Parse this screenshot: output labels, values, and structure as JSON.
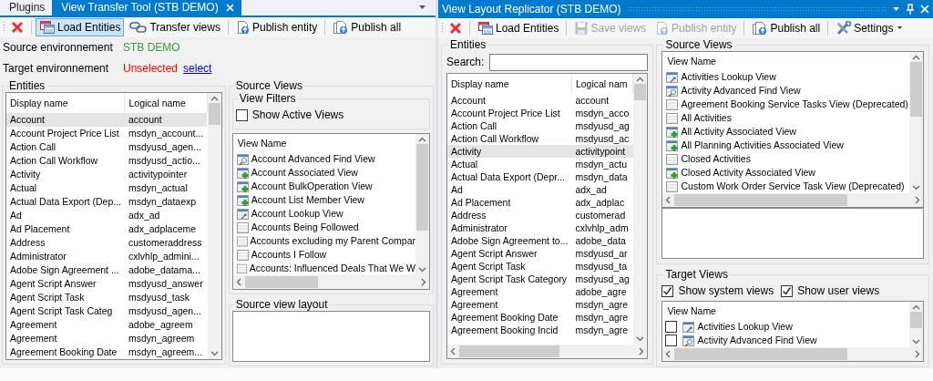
{
  "left_panel": {
    "tabs": [
      {
        "label": "Plugins",
        "selected": false
      },
      {
        "label": "View Transfer Tool (STB DEMO)",
        "selected": true
      }
    ],
    "toolbar": [
      {
        "kind": "close",
        "separator": false,
        "pressed": false
      },
      {
        "kind": "load",
        "label": "Load Entities",
        "separator": true,
        "pressed": true
      },
      {
        "kind": "transfer",
        "label": "Transfer views",
        "separator": false,
        "pressed": false
      },
      {
        "kind": "publish",
        "label": "Publish entity",
        "separator": true,
        "pressed": false
      },
      {
        "kind": "publish_all",
        "label": "Publish all",
        "separator": true,
        "pressed": false
      }
    ],
    "source_environment": {
      "label": "Source environnement",
      "value": "STB DEMO",
      "color": "#3c9a3c"
    },
    "target_environment": {
      "label": "Target environnement",
      "value": "Unselected",
      "color": "#ff0000",
      "link": "select"
    },
    "entities": {
      "title": "Entities",
      "columns": [
        "Display name",
        "Logical name"
      ],
      "rows": [
        {
          "cells": [
            "Account",
            "account"
          ],
          "selected": true
        },
        {
          "cells": [
            "Account Project Price List",
            "msdyn_account..."
          ],
          "selected": false
        },
        {
          "cells": [
            "Action Call",
            "msdyusd_agen..."
          ],
          "selected": false
        },
        {
          "cells": [
            "Action Call Workflow",
            "msdyusd_actio..."
          ],
          "selected": false
        },
        {
          "cells": [
            "Activity",
            "activitypointer"
          ],
          "selected": false
        },
        {
          "cells": [
            "Actual",
            "msdyn_actual"
          ],
          "selected": false
        },
        {
          "cells": [
            "Actual Data Export (Dep...",
            "msdyn_dataexp"
          ],
          "selected": false
        },
        {
          "cells": [
            "Ad",
            "adx_ad"
          ],
          "selected": false
        },
        {
          "cells": [
            "Ad Placement",
            "adx_adplaceme"
          ],
          "selected": false
        },
        {
          "cells": [
            "Address",
            "customeraddress"
          ],
          "selected": false
        },
        {
          "cells": [
            "Administrator",
            "cxlvhlp_admini..."
          ],
          "selected": false
        },
        {
          "cells": [
            "Adobe Sign Agreement ...",
            "adobe_datama..."
          ],
          "selected": false
        },
        {
          "cells": [
            "Agent Script Answer",
            "msdyusd_answer"
          ],
          "selected": false
        },
        {
          "cells": [
            "Agent Script Task",
            "msdyusd_task"
          ],
          "selected": false
        },
        {
          "cells": [
            "Agent Script Task Categ",
            "msdyusd_agen..."
          ],
          "selected": false
        },
        {
          "cells": [
            "Agreement",
            "adobe_agreem"
          ],
          "selected": false
        },
        {
          "cells": [
            "Agreement",
            "msdyn_agreem"
          ],
          "selected": false
        },
        {
          "cells": [
            "Agreement Booking Date",
            "msdyn_agreem..."
          ],
          "selected": false
        }
      ]
    },
    "source_views": {
      "title": "Source Views",
      "filters": {
        "title": "View Filters",
        "label": "Show Active Views",
        "checked": false
      },
      "columns": [
        "View Name"
      ],
      "rows": [
        {
          "kind": "find",
          "label": "Account Advanced Find View",
          "selected": false
        },
        {
          "kind": "associated",
          "label": "Account Associated View",
          "selected": false
        },
        {
          "kind": "associated",
          "label": "Account BulkOperation View",
          "selected": false
        },
        {
          "kind": "associated",
          "label": "Account List Member View",
          "selected": false
        },
        {
          "kind": "lookup",
          "label": "Account Lookup View",
          "selected": false
        },
        {
          "kind": "grid",
          "label": "Accounts Being Followed",
          "selected": false
        },
        {
          "kind": "grid",
          "label": "Accounts excluding my Parent Compar",
          "selected": false
        },
        {
          "kind": "grid",
          "label": "Accounts I Follow",
          "selected": false
        },
        {
          "kind": "grid",
          "label": "Accounts: Influenced Deals That We W",
          "selected": false
        }
      ],
      "layout_title": "Source view layout"
    }
  },
  "right_panel": {
    "title": "View Layout Replicator (STB DEMO)",
    "toolbar": [
      {
        "kind": "close",
        "separator": false,
        "disabled": false
      },
      {
        "kind": "load",
        "label": "Load Entities",
        "separator": true,
        "disabled": false
      },
      {
        "kind": "save",
        "label": "Save views",
        "separator": true,
        "disabled": true
      },
      {
        "kind": "publish",
        "label": "Publish entity",
        "separator": false,
        "disabled": true
      },
      {
        "kind": "publish_all",
        "label": "Publish all",
        "separator": true,
        "disabled": false
      },
      {
        "kind": "settings",
        "label": "Settings",
        "separator": true,
        "disabled": false
      }
    ],
    "entities": {
      "title": "Entities",
      "search_label": "Search:",
      "columns": [
        "Display name",
        "Logical nam"
      ],
      "rows": [
        {
          "cells": [
            "Account",
            "account"
          ],
          "selected": false
        },
        {
          "cells": [
            "Account Project Price List",
            "msdyn_acco"
          ],
          "selected": false
        },
        {
          "cells": [
            "Action Call",
            "msdyusd_ag"
          ],
          "selected": false
        },
        {
          "cells": [
            "Action Call Workflow",
            "msdyusd_ac"
          ],
          "selected": false
        },
        {
          "cells": [
            "Activity",
            "activitypoint"
          ],
          "selected": true
        },
        {
          "cells": [
            "Actual",
            "msdyn_actu"
          ],
          "selected": false
        },
        {
          "cells": [
            "Actual Data Export (Depr...",
            "msdyn_data"
          ],
          "selected": false
        },
        {
          "cells": [
            "Ad",
            "adx_ad"
          ],
          "selected": false
        },
        {
          "cells": [
            "Ad Placement",
            "adx_adplac"
          ],
          "selected": false
        },
        {
          "cells": [
            "Address",
            "customerad"
          ],
          "selected": false
        },
        {
          "cells": [
            "Administrator",
            "cxlvhlp_adm"
          ],
          "selected": false
        },
        {
          "cells": [
            "Adobe Sign Agreement to...",
            "adobe_data"
          ],
          "selected": false
        },
        {
          "cells": [
            "Agent Script Answer",
            "msdyusd_ar"
          ],
          "selected": false
        },
        {
          "cells": [
            "Agent Script Task",
            "msdyusd_ta"
          ],
          "selected": false
        },
        {
          "cells": [
            "Agent Script Task Category",
            "msdyusd_ag"
          ],
          "selected": false
        },
        {
          "cells": [
            "Agreement",
            "adobe_agre"
          ],
          "selected": false
        },
        {
          "cells": [
            "Agreement",
            "msdyn_agre"
          ],
          "selected": false
        },
        {
          "cells": [
            "Agreement Booking Date",
            "msdyn_agre"
          ],
          "selected": false
        },
        {
          "cells": [
            "Agreement Booking Incid",
            "msdyn_agre"
          ],
          "selected": false
        }
      ]
    },
    "source_views": {
      "title": "Source Views",
      "columns": [
        "View Name"
      ],
      "rows": [
        {
          "kind": "lookup",
          "label": "Activities Lookup View",
          "selected": false
        },
        {
          "kind": "find",
          "label": "Activity Advanced Find View",
          "selected": false
        },
        {
          "kind": "grid",
          "label": "Agreement Booking Service Tasks View (Deprecated)",
          "selected": false
        },
        {
          "kind": "grid",
          "label": "All Activities",
          "selected": false
        },
        {
          "kind": "associated",
          "label": "All Activity Associated View",
          "selected": false
        },
        {
          "kind": "associated",
          "label": "All Planning Activities Associated View",
          "selected": false
        },
        {
          "kind": "grid",
          "label": "Closed Activities",
          "selected": false
        },
        {
          "kind": "associated",
          "label": "Closed Activity Associated View",
          "selected": false
        },
        {
          "kind": "grid",
          "label": "Custom Work Order Service Task View (Deprecated)",
          "selected": false
        }
      ]
    },
    "target_views": {
      "title": "Target Views",
      "options": [
        {
          "label": "Show system views",
          "checked": true
        },
        {
          "label": "Show user views",
          "checked": true
        }
      ],
      "columns": [
        "View Name"
      ],
      "rows": [
        {
          "kind": "lookup",
          "label": "Activities Lookup View",
          "checked": false
        },
        {
          "kind": "find",
          "label": "Activity Advanced Find View",
          "checked": false
        }
      ]
    }
  }
}
